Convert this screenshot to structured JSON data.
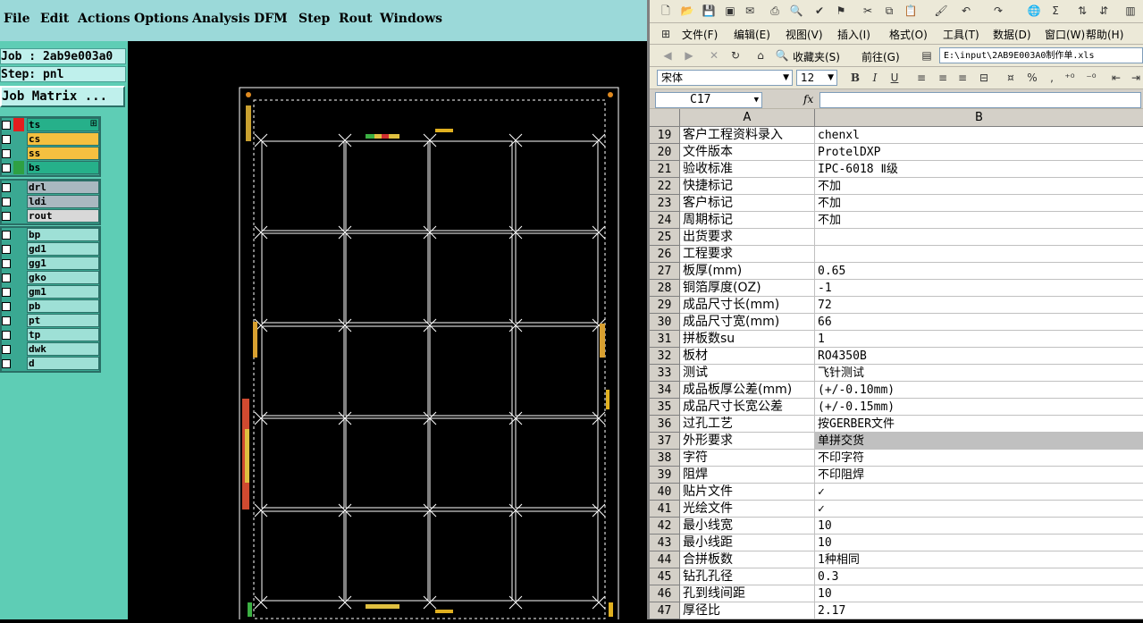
{
  "cam": {
    "menu": [
      "File",
      "Edit",
      "Actions",
      "Options",
      "Analysis",
      "DFM",
      "Step",
      "Rout",
      "Windows"
    ],
    "job": "Job : 2ab9e003a0",
    "step": "Step: pnl",
    "job_matrix": "Job Matrix ...",
    "layers_group1": [
      {
        "name": "ts",
        "color": "#e41e1e",
        "bg": "#26b08a",
        "marker": "⊞"
      },
      {
        "name": "cs",
        "color": "",
        "bg": "#f5c040",
        "marker": ""
      },
      {
        "name": "ss",
        "color": "",
        "bg": "#f5c040",
        "marker": ""
      },
      {
        "name": "bs",
        "color": "#2ea043",
        "bg": "#26b08a",
        "marker": ""
      }
    ],
    "layers_group2": [
      {
        "name": "drl",
        "bg": "#a9b8c0"
      },
      {
        "name": "ldi",
        "bg": "#a9b8c0"
      },
      {
        "name": "rout",
        "bg": "#d8d8d8"
      }
    ],
    "layers_group3": [
      {
        "name": "bp"
      },
      {
        "name": "gd1"
      },
      {
        "name": "gg1"
      },
      {
        "name": "gko"
      },
      {
        "name": "gm1"
      },
      {
        "name": "pb"
      },
      {
        "name": "pt"
      },
      {
        "name": "tp"
      },
      {
        "name": "dwk"
      },
      {
        "name": "d"
      }
    ]
  },
  "excel": {
    "menu": [
      "文件(F)",
      "编辑(E)",
      "视图(V)",
      "插入(I)",
      "格式(O)",
      "工具(T)",
      "数据(D)",
      "窗口(W)",
      "帮助(H)"
    ],
    "favorites": "收藏夹(S)",
    "goto": "前往(G)",
    "address": "E:\\input\\2AB9E003A0制作单.xls",
    "font_name": "宋体",
    "font_size": "12",
    "name_box": "C17",
    "fx": "fx",
    "col_a": "A",
    "col_b": "B",
    "rows": [
      {
        "n": "19",
        "a": "客户工程资料录入",
        "b": "chenxl"
      },
      {
        "n": "20",
        "a": "文件版本",
        "b": "ProtelDXP"
      },
      {
        "n": "21",
        "a": "验收标准",
        "b": "IPC-6018 Ⅱ级"
      },
      {
        "n": "22",
        "a": "快捷标记",
        "b": "不加"
      },
      {
        "n": "23",
        "a": "客户标记",
        "b": "不加"
      },
      {
        "n": "24",
        "a": "周期标记",
        "b": "不加"
      },
      {
        "n": "25",
        "a": "出货要求",
        "b": ""
      },
      {
        "n": "26",
        "a": "工程要求",
        "b": ""
      },
      {
        "n": "27",
        "a": "板厚(mm)",
        "b": "0.65"
      },
      {
        "n": "28",
        "a": "铜箔厚度(OZ)",
        "b": "-1"
      },
      {
        "n": "29",
        "a": "成品尺寸长(mm)",
        "b": "72"
      },
      {
        "n": "30",
        "a": "成品尺寸宽(mm)",
        "b": "66"
      },
      {
        "n": "31",
        "a": "拼板数su",
        "b": "1"
      },
      {
        "n": "32",
        "a": "板材",
        "b": "RO4350B"
      },
      {
        "n": "33",
        "a": "测试",
        "b": "飞针测试"
      },
      {
        "n": "34",
        "a": "成品板厚公差(mm)",
        "b": "(+/-0.10mm)"
      },
      {
        "n": "35",
        "a": "成品尺寸长宽公差",
        "b": "(+/-0.15mm)"
      },
      {
        "n": "36",
        "a": "过孔工艺",
        "b": "按GERBER文件"
      },
      {
        "n": "37",
        "a": "外形要求",
        "b": "单拼交货"
      },
      {
        "n": "38",
        "a": "字符",
        "b": "不印字符"
      },
      {
        "n": "39",
        "a": "阻焊",
        "b": "不印阻焊"
      },
      {
        "n": "40",
        "a": "贴片文件",
        "b": "✓"
      },
      {
        "n": "41",
        "a": "光绘文件",
        "b": "✓"
      },
      {
        "n": "42",
        "a": "最小线宽",
        "b": "10"
      },
      {
        "n": "43",
        "a": "最小线距",
        "b": "10"
      },
      {
        "n": "44",
        "a": "合拼板数",
        "b": "1种相同"
      },
      {
        "n": "45",
        "a": "钻孔孔径",
        "b": "0.3"
      },
      {
        "n": "46",
        "a": "孔到线间距",
        "b": "10"
      },
      {
        "n": "47",
        "a": "厚径比",
        "b": "2.17"
      }
    ],
    "selected_row": "37"
  }
}
